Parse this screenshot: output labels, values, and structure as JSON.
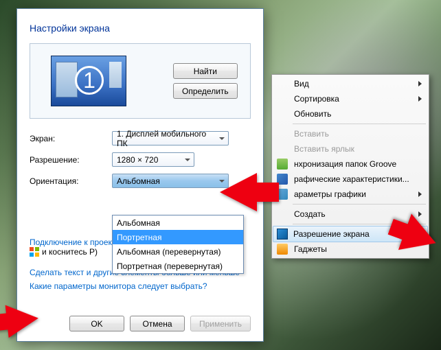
{
  "window": {
    "title": "Настройки экрана",
    "monitor_number": "1",
    "buttons": {
      "find": "Найти",
      "detect": "Определить"
    },
    "labels": {
      "screen": "Экран:",
      "resolution": "Разрешение:",
      "orientation": "Ориентация:"
    },
    "combos": {
      "screen": "1. Дисплей мобильного ПК",
      "resolution": "1280 × 720",
      "orientation": "Альбомная"
    },
    "orientation_options": [
      {
        "label": "Альбомная",
        "selected": false
      },
      {
        "label": "Портретная",
        "selected": true
      },
      {
        "label": "Альбомная (перевернутая)",
        "selected": false
      },
      {
        "label": "Портретная (перевернутая)",
        "selected": false
      }
    ],
    "projector_line1": "Подключение к проек",
    "projector_line2": "и коснитесь P)",
    "link_text_size": "Сделать текст и другие элементы больше или меньше",
    "link_which_params": "Какие параметры монитора следует выбрать?",
    "footer": {
      "ok": "OK",
      "cancel": "Отмена",
      "apply": "Применить"
    }
  },
  "context_menu": {
    "items": [
      {
        "label": "Вид",
        "flyout": true
      },
      {
        "label": "Сортировка",
        "flyout": true
      },
      {
        "label": "Обновить"
      },
      {
        "sep": true
      },
      {
        "label": "Вставить",
        "disabled": true
      },
      {
        "label": "Вставить ярлык",
        "disabled": true
      },
      {
        "label": "нхронизация папок Groove",
        "icon": "ic-groove"
      },
      {
        "label": "рафические характеристики...",
        "icon": "ic-gfx"
      },
      {
        "label": "араметры графики",
        "flyout": true,
        "icon": "ic-gfx2"
      },
      {
        "sep": true
      },
      {
        "label": "Создать",
        "flyout": true
      },
      {
        "sep": true
      },
      {
        "label": "Разрешение экрана",
        "icon": "ic-res",
        "selected": true
      },
      {
        "label": "Гаджеты",
        "icon": "ic-gadget"
      }
    ]
  }
}
